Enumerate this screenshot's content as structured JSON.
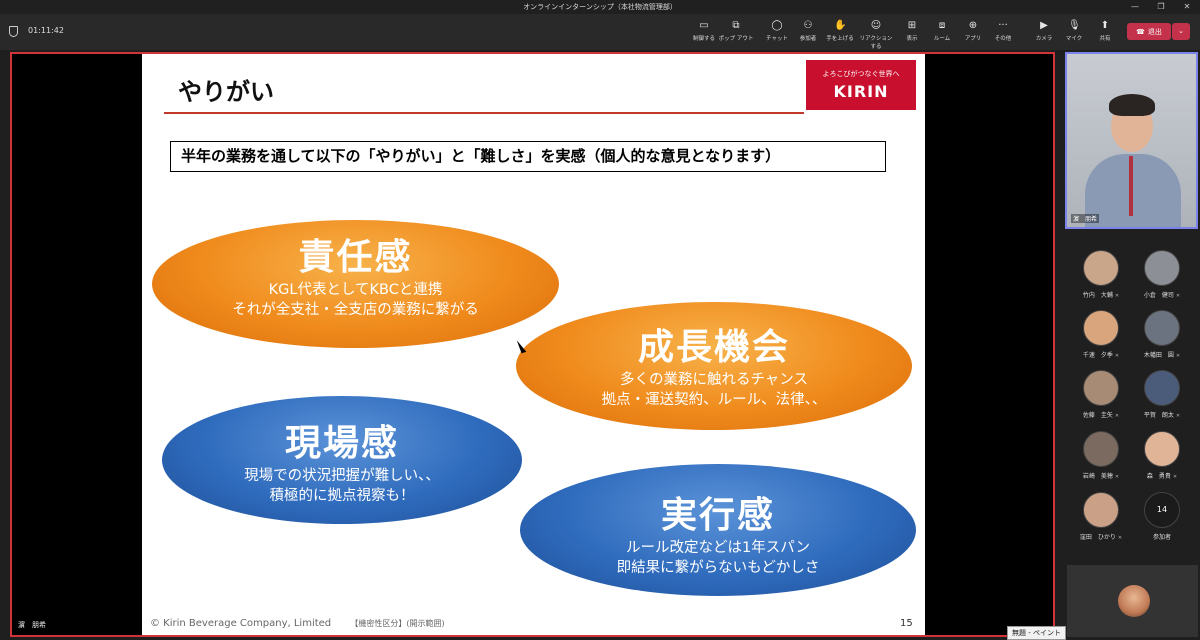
{
  "window": {
    "title": "オンラインインターンシップ（本社物流管理部）",
    "controls": [
      "—",
      "❐",
      "✕"
    ]
  },
  "toolbar": {
    "timer": "01:11:42",
    "buttons": [
      {
        "label": "制御する",
        "icon": "▭"
      },
      {
        "label": "ポップ アウト",
        "icon": "⧉"
      },
      {
        "label": "チャット",
        "icon": "◯"
      },
      {
        "label": "参加者",
        "icon": "⚇"
      },
      {
        "label": "手を上げる",
        "icon": "✋"
      },
      {
        "label": "リアクションする",
        "icon": "☺"
      },
      {
        "label": "表示",
        "icon": "⊞"
      },
      {
        "label": "ルーム",
        "icon": "⧈"
      },
      {
        "label": "アプリ",
        "icon": "⊕"
      },
      {
        "label": "その他",
        "icon": "···"
      },
      {
        "label": "カメラ",
        "icon": "▶"
      },
      {
        "label": "マイク",
        "icon": "🎙"
      },
      {
        "label": "共有",
        "icon": "⬆"
      }
    ],
    "leave_label": "退出",
    "leave_dropdown": "⌄"
  },
  "slide": {
    "title": "やりがい",
    "logo_tagline": "よろこびがつなぐ世界へ",
    "logo_name": "KIRIN",
    "subtitle": "半年の業務を通して以下の「やりがい」と「難しさ」を実感（個人的な意見となります）",
    "ovals": [
      {
        "title": "責任感",
        "lines": [
          "KGL代表としてKBCと連携",
          "それが全支社・全支店の業務に繋がる"
        ]
      },
      {
        "title": "成長機会",
        "lines": [
          "多くの業務に触れるチャンス",
          "拠点・運送契約、ルール、法律、、"
        ]
      },
      {
        "title": "現場感",
        "lines": [
          "現場での状況把握が難しい、、",
          "積極的に拠点視察も！"
        ]
      },
      {
        "title": "実行感",
        "lines": [
          "ルール改定などは1年スパン",
          "即結果に繋がらないもどかしさ"
        ]
      }
    ],
    "footer": "© Kirin Beverage Company, Limited",
    "classification": "【機密性区分】(開示範囲)",
    "page_number": "15"
  },
  "presenter_name": "濵　朋希",
  "self_video_name": "濵　朋希",
  "participants": [
    {
      "name": "竹内　大輔",
      "color": "#c9a58a"
    },
    {
      "name": "小倉　健司",
      "color": "#8c8f95"
    },
    {
      "name": "千速　夕季",
      "color": "#d9a57c"
    },
    {
      "name": "木幡田　圓",
      "color": "#6b7280"
    },
    {
      "name": "佐藤　圭矢",
      "color": "#a88b74"
    },
    {
      "name": "平賀　朗太",
      "color": "#4b5b7a"
    },
    {
      "name": "岩崎　美穂",
      "color": "#7a6a60"
    },
    {
      "name": "森　勇貴",
      "color": "#e0b597"
    },
    {
      "name": "窪田　ひかり",
      "color": "#caa187"
    }
  ],
  "more_participants": {
    "count": "14",
    "label": "参加者"
  },
  "tooltip": "無題 - ペイント"
}
